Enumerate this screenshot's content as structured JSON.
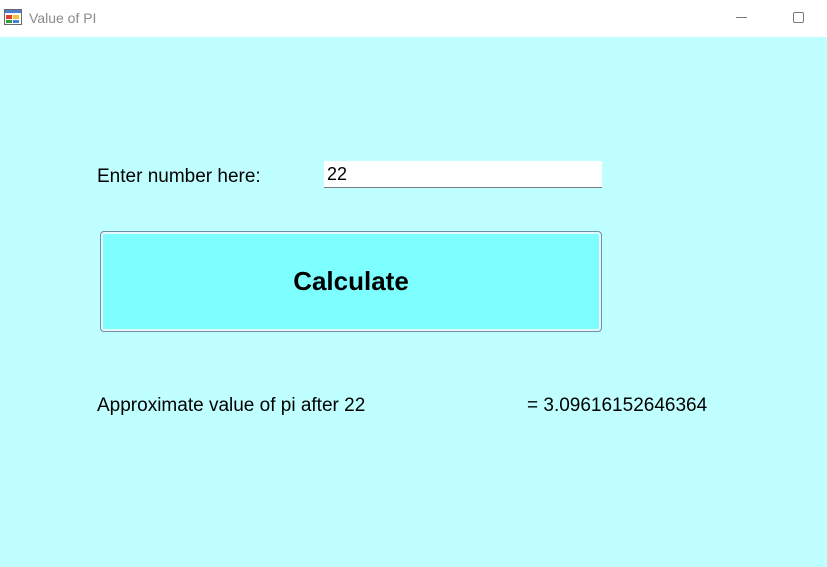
{
  "window": {
    "title": "Value of PI",
    "icon": "windows-form-icon",
    "controls": [
      "minimize",
      "maximize"
    ]
  },
  "form": {
    "prompt_label": "Enter number here:",
    "input_value": "22",
    "button_label": "Calculate",
    "result_label": "Approximate value of pi after 22",
    "result_value": "= 3.09616152646364"
  },
  "colors": {
    "background": "#c0ffff",
    "button": "#7effff",
    "titlebar": "#ffffff"
  }
}
